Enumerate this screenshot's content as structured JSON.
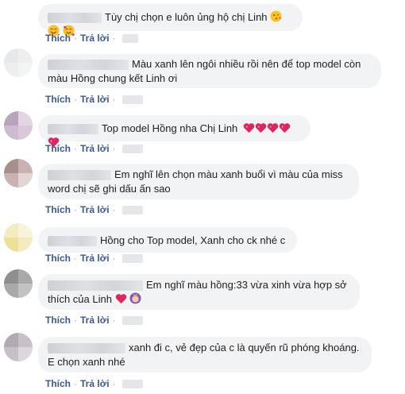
{
  "actions": {
    "like": "Thích",
    "reply": "Trả lời",
    "separator": "·"
  },
  "comments": [
    {
      "text": "Tùy chị chọn e luôn ủng hộ chị Linh",
      "emojis": [
        "kissing-face",
        "smiling-face",
        "smiling-hearts-face"
      ]
    },
    {
      "text": "Màu xanh lên ngôi nhiều rồi nên để top model còn màu Hồng chung kết Linh ơi",
      "emojis": []
    },
    {
      "text": "Top model Hồng nha Chị Linh",
      "emojis": [
        "sparkling-heart",
        "sparkling-heart",
        "sparkling-heart",
        "sparkling-heart",
        "sparkling-heart"
      ]
    },
    {
      "text": "Em nghĩ lên chọn màu xanh buổi vì màu của miss word chị sẽ ghi dấu ấn sao",
      "emojis": []
    },
    {
      "text": "Hồng cho Top model, Xanh cho ck nhé c",
      "emojis": []
    },
    {
      "text": "Em nghĩ màu hồng:33 vừa xinh vừa hợp sở thích của Linh",
      "emojis": [
        "red-heart",
        "princess"
      ]
    },
    {
      "text": "xanh đi c, vẻ đẹp của c là quyến rũ phóng khoáng. E chọn xanh nhé",
      "emojis": []
    }
  ],
  "colors": {
    "bubble": "#f2f3f5",
    "link": "#385898",
    "heart": "#e0245e"
  }
}
